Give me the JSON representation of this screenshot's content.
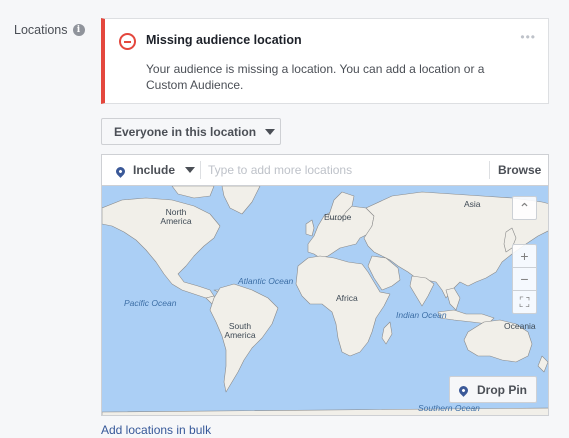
{
  "section": {
    "label": "Locations",
    "info_icon": "info-icon"
  },
  "alert": {
    "title": "Missing audience location",
    "body": "Your audience is missing a location. You can add a location or a Custom Audience.",
    "icon": "minus-circle-icon",
    "accent_color": "#e4473d"
  },
  "audience_dropdown": {
    "selected": "Everyone in this location"
  },
  "location_search": {
    "mode": "Include",
    "placeholder": "Type to add more locations",
    "value": "",
    "browse_label": "Browse"
  },
  "map": {
    "labels": {
      "north_america": "North America",
      "europe": "Europe",
      "asia": "Asia",
      "africa": "Africa",
      "south_america": "South America",
      "oceania": "Oceania"
    },
    "oceans": {
      "atlantic": "Atlantic Ocean",
      "pacific": "Pacific Ocean",
      "indian": "Indian Ocean",
      "southern": "Southern Ocean"
    },
    "drop_pin_label": "Drop Pin",
    "zoom_in_symbol": "+",
    "zoom_out_symbol": "−"
  },
  "bulk_link": "Add locations in bulk"
}
